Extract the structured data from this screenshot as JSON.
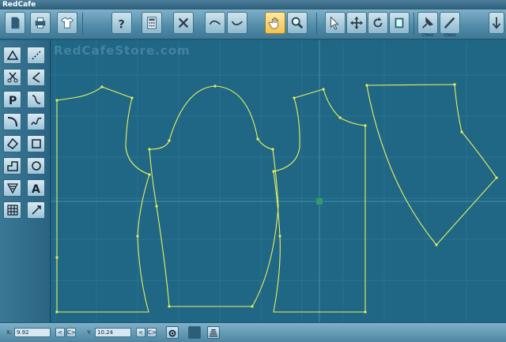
{
  "window": {
    "title": "RedCafe"
  },
  "toolbar": {
    "buttons": [
      {
        "id": "new",
        "icon": "new-page-icon"
      },
      {
        "id": "print",
        "icon": "printer-icon"
      },
      {
        "id": "garment",
        "icon": "tshirt-icon"
      },
      {
        "id": "help",
        "icon": "question-icon"
      },
      {
        "id": "calculator",
        "icon": "calculator-icon"
      },
      {
        "id": "delete",
        "icon": "close-x-icon"
      },
      {
        "id": "undo",
        "icon": "undo-curve-icon"
      },
      {
        "id": "redo",
        "icon": "redo-curve-icon"
      },
      {
        "id": "pan",
        "icon": "hand-icon"
      },
      {
        "id": "zoom",
        "icon": "magnifier-icon"
      },
      {
        "id": "select",
        "icon": "arrow-pointer-icon"
      },
      {
        "id": "move",
        "icon": "move-arrows-icon"
      },
      {
        "id": "rotate",
        "icon": "rotate-icon"
      },
      {
        "id": "mirror",
        "icon": "mirror-icon"
      },
      {
        "id": "pin",
        "icon": "pin-icon",
        "label": "Cfono"
      },
      {
        "id": "pen",
        "icon": "pen-icon",
        "label": "Cfono"
      },
      {
        "id": "extra",
        "icon": "down-arrow-icon"
      }
    ]
  },
  "canvas": {
    "watermark": "RedCafeStore.com"
  },
  "status": {
    "x_label": "X:",
    "x_value": "9.92",
    "y_label": "Y:",
    "y_value": "10.24",
    "prev": "<",
    "next": "C>"
  },
  "colors": {
    "pattern_line": "#e8f060",
    "grid": "#2f7896",
    "background": "#1f6785"
  }
}
